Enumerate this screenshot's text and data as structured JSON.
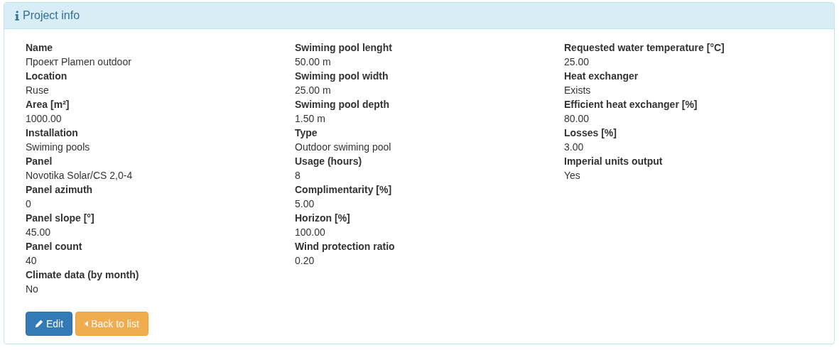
{
  "panel": {
    "title": "Project info"
  },
  "columns": [
    [
      {
        "label": "Name",
        "value": "Проект Plamen outdoor"
      },
      {
        "label": "Location",
        "value": "Ruse"
      },
      {
        "label": "Area [m²]",
        "value": "1000.00"
      },
      {
        "label": "Installation",
        "value": "Swiming pools"
      },
      {
        "label": "Panel",
        "value": "Novotika Solar/CS 2,0-4"
      },
      {
        "label": "Panel azimuth",
        "value": "0"
      },
      {
        "label": "Panel slope [°]",
        "value": "45.00"
      },
      {
        "label": "Panel count",
        "value": "40"
      },
      {
        "label": "Climate data (by month)",
        "value": "No"
      }
    ],
    [
      {
        "label": "Swiming pool lenght",
        "value": "50.00 m"
      },
      {
        "label": "Swiming pool width",
        "value": "25.00 m"
      },
      {
        "label": "Swiming pool depth",
        "value": "1.50 m"
      },
      {
        "label": "Type",
        "value": "Outdoor swiming pool"
      },
      {
        "label": "Usage (hours)",
        "value": "8"
      },
      {
        "label": "Complimentarity [%]",
        "value": "5.00"
      },
      {
        "label": "Horizon [%]",
        "value": "100.00"
      },
      {
        "label": "Wind protection ratio",
        "value": "0.20"
      }
    ],
    [
      {
        "label": "Requested water temperature [°C]",
        "value": "25.00"
      },
      {
        "label": "Heat exchanger",
        "value": "Exists"
      },
      {
        "label": "Efficient heat exchanger [%]",
        "value": "80.00"
      },
      {
        "label": "Losses [%]",
        "value": "3.00"
      },
      {
        "label": "Imperial units output",
        "value": "Yes"
      }
    ]
  ],
  "buttons": [
    {
      "label": "Edit",
      "kind": "edit"
    },
    {
      "label": "Back to list",
      "kind": "back"
    }
  ]
}
